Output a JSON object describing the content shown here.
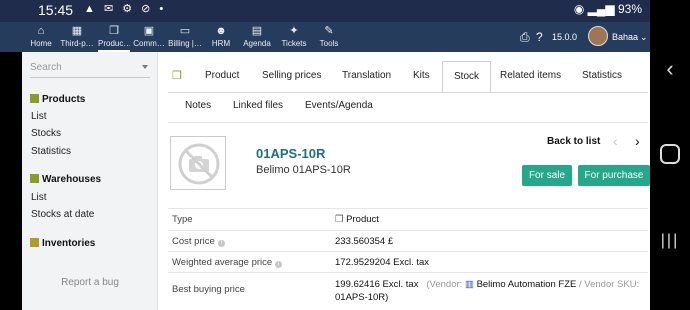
{
  "status": {
    "time": "15:45",
    "battery": "93%"
  },
  "nav": {
    "items": [
      {
        "label": "Home",
        "icon": "home-icon"
      },
      {
        "label": "Third-p…",
        "icon": "building-icon"
      },
      {
        "label": "Produc…",
        "icon": "cube-icon"
      },
      {
        "label": "Comm…",
        "icon": "suitcase-icon"
      },
      {
        "label": "Billing |…",
        "icon": "money-icon"
      },
      {
        "label": "HRM",
        "icon": "user-icon"
      },
      {
        "label": "Agenda",
        "icon": "calendar-icon"
      },
      {
        "label": "Tickets",
        "icon": "ticket-icon"
      },
      {
        "label": "Tools",
        "icon": "wrench-icon"
      }
    ],
    "version": "15.0.0",
    "user": "Bahaa"
  },
  "sidebar": {
    "search_placeholder": "Search",
    "sections": [
      {
        "title": "Products",
        "items": [
          "List",
          "Stocks",
          "Statistics"
        ]
      },
      {
        "title": "Warehouses",
        "items": [
          "List",
          "Stocks at date"
        ]
      },
      {
        "title": "Inventories",
        "items": []
      }
    ],
    "report_bug": "Report a bug"
  },
  "tabs": [
    "Product",
    "Selling prices",
    "Translation",
    "Kits",
    "Stock",
    "Related items",
    "Statistics",
    "Notes",
    "Linked files",
    "Events/Agenda"
  ],
  "active_tab": "Stock",
  "product": {
    "ref": "01APS-10R",
    "label": "Belimo 01APS-10R",
    "back_to_list": "Back to list",
    "for_sale": "For sale",
    "for_purchase": "For purchase"
  },
  "details": [
    {
      "label": "Type",
      "value": "Product"
    },
    {
      "label": "Cost price",
      "value": "233.560354 £"
    },
    {
      "label": "Weighted average price",
      "value": "172.9529204 Excl. tax"
    },
    {
      "label": "Best buying price",
      "value": "199.62416 Excl. tax",
      "vendor_prefix": "(Vendor:",
      "vendor": "Belimo Automation FZE",
      "sku_label": "/ Vendor SKU:",
      "sku": "01APS-10R)"
    }
  ],
  "colors": {
    "topbar": "#263c5c",
    "accent_button": "#25a88a",
    "ref_link": "#1e6f7f",
    "product_icon": "#8a9a2b"
  }
}
